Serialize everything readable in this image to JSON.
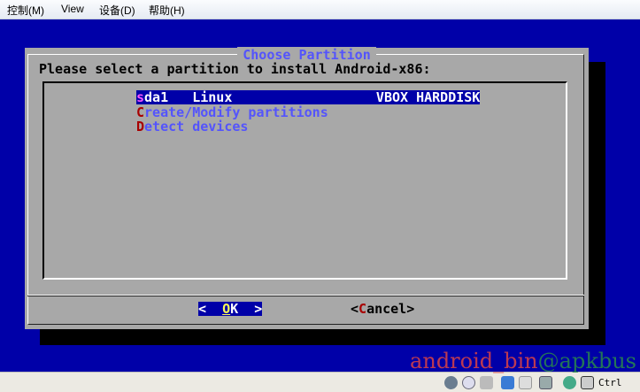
{
  "menubar": {
    "items": [
      "控制(M)",
      "View",
      "设备(D)",
      "帮助(H)"
    ]
  },
  "dialog": {
    "title": "Choose Partition",
    "prompt": "Please select a partition to install Android-x86:",
    "items": [
      {
        "hotkey": "s",
        "rest": "da1   Linux                  VBOX HARDDISK",
        "selected": true
      },
      {
        "hotkey": "C",
        "rest": "reate/Modify partitions",
        "selected": false
      },
      {
        "hotkey": "D",
        "rest": "etect devices",
        "selected": false
      }
    ],
    "ok": {
      "left": "<  ",
      "hotkey": "O",
      "rest": "K",
      "right": "  >"
    },
    "cancel": {
      "left": "<",
      "hotkey": "C",
      "rest": "ancel>"
    }
  },
  "statusbar": {
    "host_key": "Ctrl"
  },
  "watermark": {
    "part1": "android_bin",
    "part2": "@apkbus"
  },
  "colors": {
    "background": "#0000a8",
    "dialog": "#a8a8a8",
    "accent": "#5454fc"
  }
}
